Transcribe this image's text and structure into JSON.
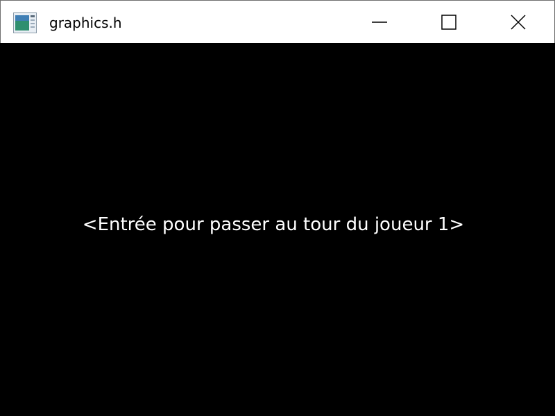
{
  "window": {
    "title": "graphics.h",
    "controls": {
      "minimize_icon": "minimize-icon",
      "maximize_icon": "maximize-icon",
      "close_icon": "close-icon"
    }
  },
  "canvas": {
    "background": "#000000",
    "message": "<Entrée pour passer au tour du joueur 1>",
    "message_color": "#ffffff"
  }
}
